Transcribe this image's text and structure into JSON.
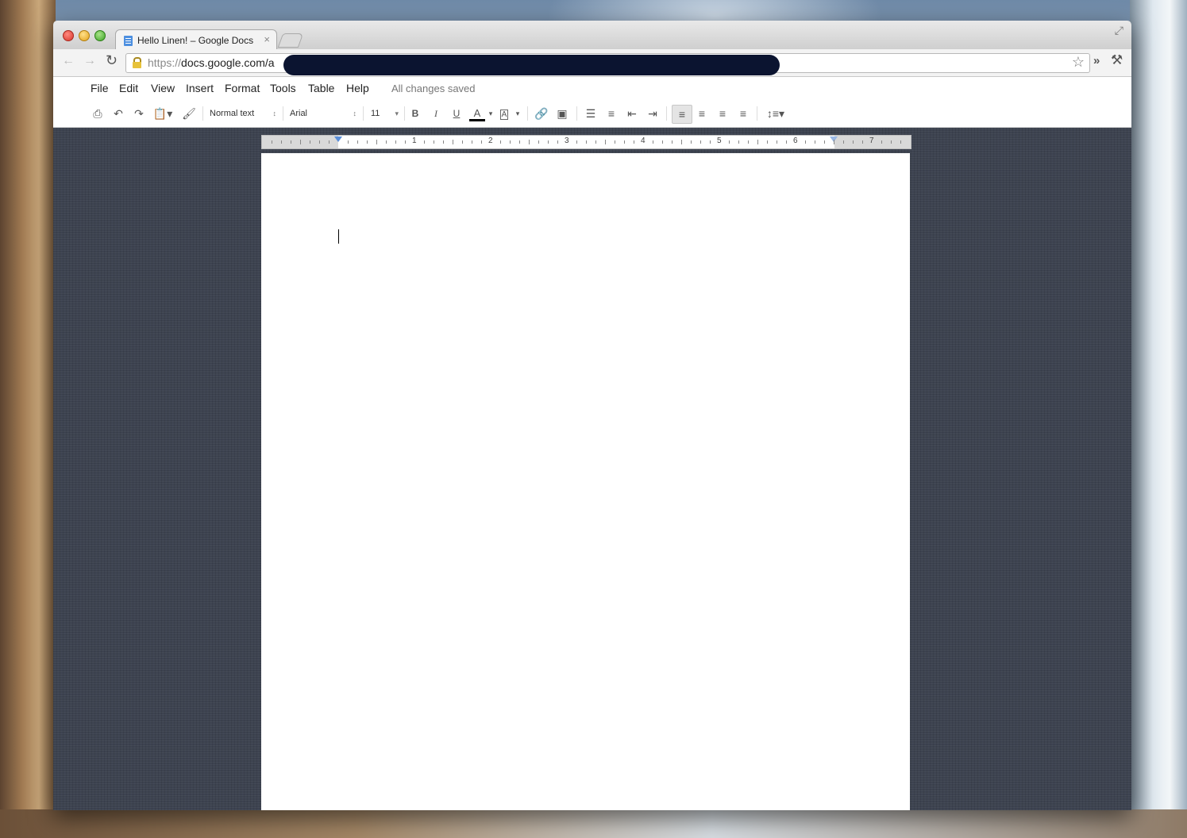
{
  "browser": {
    "tab_title": "Hello Linen! – Google Docs",
    "tab_close": "×",
    "url_scheme": "https://",
    "url_host": "docs.google.com/a",
    "star": "☆",
    "more": "»",
    "wrench": "🔧",
    "fullscreen": "⤢"
  },
  "menu": {
    "items": [
      "File",
      "Edit",
      "View",
      "Insert",
      "Format",
      "Tools",
      "Table",
      "Help"
    ],
    "status": "All changes saved"
  },
  "toolbar": {
    "style": "Normal text",
    "font": "Arial",
    "size": "11",
    "bold": "B",
    "italic": "I",
    "underline": "U",
    "text_color": "A",
    "highlight": "A"
  },
  "ruler": {
    "numbers": [
      "1",
      "2",
      "3",
      "4",
      "5",
      "6",
      "7"
    ]
  },
  "colors": {
    "linen": "#3d4350",
    "redaction": "#0b1430",
    "accent": "#5a8ed8"
  }
}
